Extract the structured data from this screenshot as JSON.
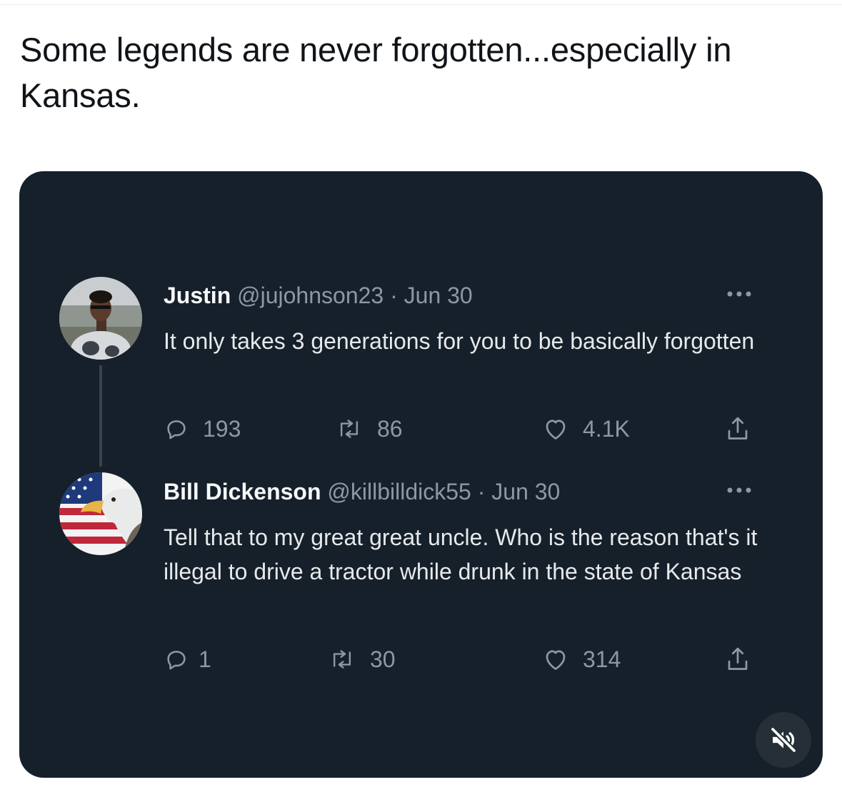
{
  "caption": "Some legends are never forgotten...especially in Kansas.",
  "tweets": [
    {
      "name": "Justin",
      "meta": "@jujohnson23 · Jun 30",
      "text": "It only takes 3 generations for you to be basically forgotten",
      "replies": "193",
      "retweets": "86",
      "likes": "4.1K"
    },
    {
      "name": "Bill Dickenson",
      "meta": "@killbilldick55 · Jun 30",
      "text": "Tell that to my great great uncle. Who is the reason that's it illegal to drive a tractor while drunk in the state of Kansas",
      "replies": "1",
      "retweets": "30",
      "likes": "314"
    }
  ],
  "icons": {
    "reply": "reply-icon",
    "retweet": "retweet-icon",
    "like": "heart-icon",
    "share": "share-icon",
    "more": "more-dots-icon",
    "mute": "muted-speaker-icon"
  },
  "colors": {
    "card_background": "#15202b",
    "name_text": "#f7f9f9",
    "body_text": "#e7e9ea",
    "secondary_text": "#8b98a5",
    "caption_text": "#0f1419"
  }
}
